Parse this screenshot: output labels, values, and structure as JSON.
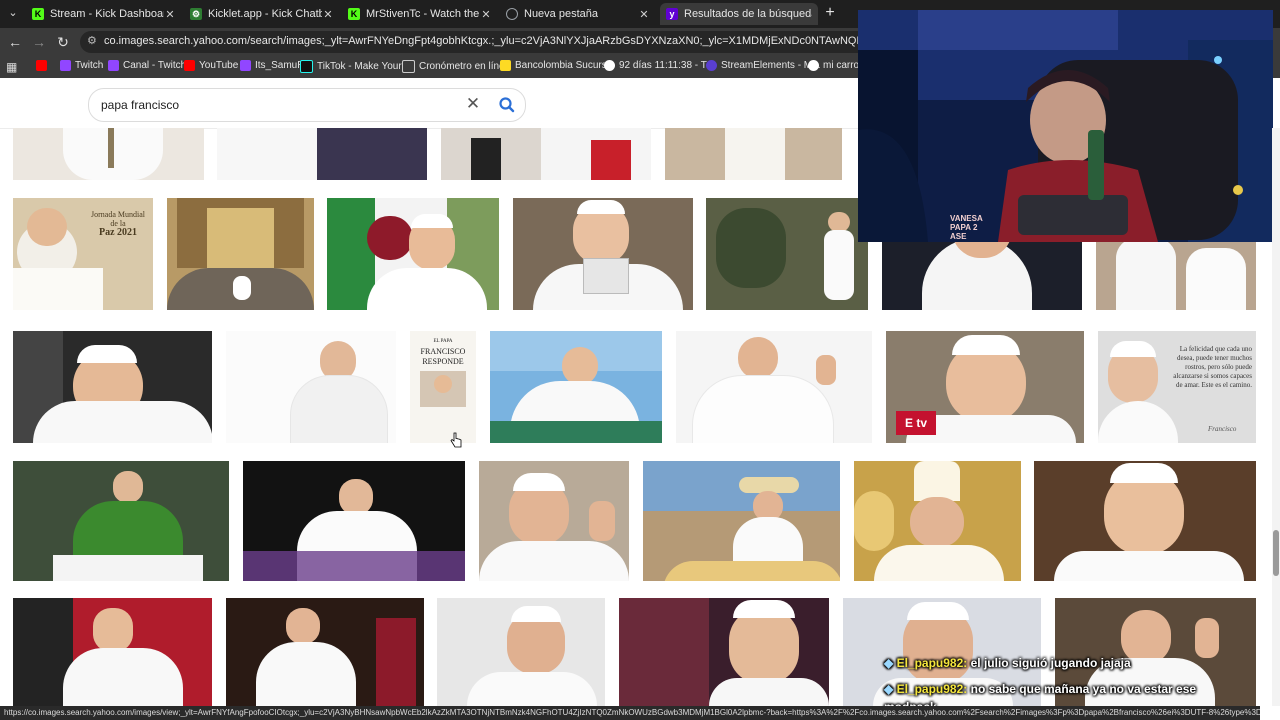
{
  "tabs": [
    {
      "title": "Stream - Kick Dashboard",
      "favicon": "kick-icon",
      "color": "#53fc18",
      "active": false
    },
    {
      "title": "Kicklet.app - Kick Chatbot and",
      "favicon": "kicklet-icon",
      "color": "#2e7d32",
      "active": false
    },
    {
      "title": "MrStivenTc - Watch the VOD o",
      "favicon": "kick-icon",
      "color": "#53fc18",
      "active": false
    },
    {
      "title": "Nueva pestaña",
      "favicon": "globe-icon",
      "color": "#9aa0a6",
      "active": false
    },
    {
      "title": "Resultados de la búsqueda de",
      "favicon": "yahoo-icon",
      "color": "#6001d2",
      "active": true
    }
  ],
  "toolbar": {
    "url": "co.images.search.yahoo.com/search/images;_ylt=AwrFNYeDngFpt4gobhKtcgx.;_ylu=c2VjA3NlYXJjaARzbGsDYXNzaXN0;_ylc=X1MDMjExNDc0NTAwNQRfcgMyBGZyA21jYWZlZQRmcgI0"
  },
  "bookmarks": [
    {
      "label": "",
      "color": "#ff0000"
    },
    {
      "label": "Twitch",
      "color": "#9146ff"
    },
    {
      "label": "Canal - Twitch",
      "color": "#9146ff"
    },
    {
      "label": "YouTube",
      "color": "#ff0000"
    },
    {
      "label": "Its_SamuR",
      "color": "#9146ff"
    },
    {
      "label": "TikTok - Make Your...",
      "color": "#111111"
    },
    {
      "label": "Cronómetro en línea",
      "color": "#ffffff"
    },
    {
      "label": "Bancolombia Sucurs...",
      "color": "#fdda24"
    },
    {
      "label": "92 días 11:11:38 - T...",
      "color": "#ffffff"
    },
    {
      "label": "StreamElements - M...",
      "color": "#5a3fd1"
    },
    {
      "label": "mi carro",
      "color": "#ffffff"
    }
  ],
  "search": {
    "query": "papa francisco"
  },
  "images": {
    "book_cover": {
      "line1": "EL PAPA",
      "line2": "FRANCISCO",
      "line3": "RESPONDE"
    },
    "jornada": {
      "line1": "Jornada Mundial",
      "line2": "de la",
      "line3": "Paz 2021"
    },
    "quote": {
      "text": "La felicidad que cada uno desea, puede tener muchos rostros, pero sólo puede alcanzarse si somos capaces de amar. Este es el camino.",
      "signature": "Francisco"
    },
    "tv_logo": "E tv"
  },
  "chat": [
    {
      "user": "El_papu982:",
      "message": "el julio siguió jugando jajaja"
    },
    {
      "user": "El_papu982:",
      "message": "no sabe que mañana ya no va estar ese",
      "continuation": "modpack"
    }
  ],
  "webcam": {
    "shirt_text": "VANESA PAPA 2 ASE"
  },
  "status_url": "https://co.images.search.yahoo.com/images/view;_ylt=AwrFNYfAngFpofooCIOtcgx;_ylu=c2VjA3NyBHNsawNpbWcEb2lkAzZkMTA3OTNjNTBmNzk4NGFhOTU4ZjIzNTQ0ZmNkOWUzBGdwb3MDMjM1BGl0A2lpbmc-?back=https%3A%2F%2Fco.images.search.yahoo.com%2Fsearch%2Fimages%3Fp%3Dpapa%2Bfrancisco%26ei%3DUTF-8%26type%3DE210C..."
}
